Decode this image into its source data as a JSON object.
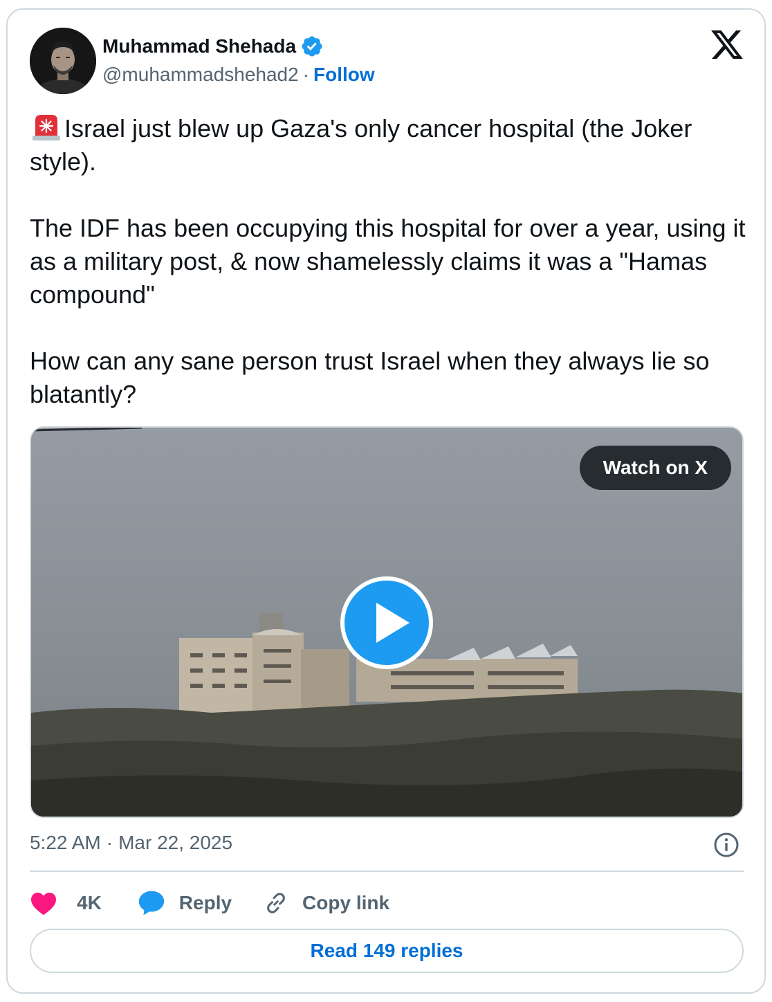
{
  "author": {
    "name": "Muhammad Shehada",
    "handle": "@muhammadshehad2",
    "separator": "·",
    "follow_label": "Follow",
    "verified": true
  },
  "tweet": {
    "emoji": "siren-icon",
    "text": "Israel just blew up Gaza's only cancer hospital (the Joker style).\n\nThe IDF has been occupying this hospital for over a year, using it as a military post, & now shamelessly claims it was a \"Hamas compound\"\n\nHow can any sane person trust Israel when they always lie so blatantly?"
  },
  "media": {
    "watch_label": "Watch on X",
    "play_icon": "play-icon"
  },
  "meta": {
    "time": "5:22 AM",
    "separator": "·",
    "date": "Mar 22, 2025"
  },
  "actions": {
    "like_count": "4K",
    "reply_label": "Reply",
    "copy_label": "Copy link"
  },
  "read_replies_label": "Read 149 replies",
  "colors": {
    "link": "#006fd6",
    "play_button": "#1d9bf0",
    "like_heart": "#f91880",
    "reply_bubble": "#1d9bf0",
    "border": "#cfd9de",
    "muted_text": "#536471"
  }
}
